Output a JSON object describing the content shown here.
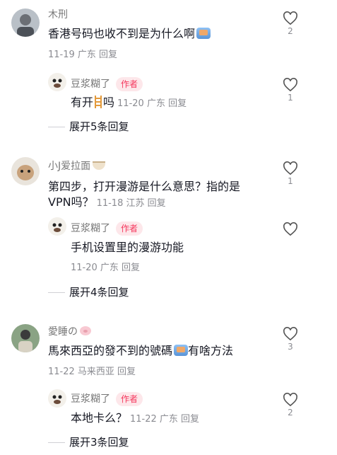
{
  "comments": [
    {
      "username": "木刑",
      "text_before": "香港号码也收不到是为什么啊",
      "text_after": "",
      "meta": "11-19 广东 回复",
      "likes": "2",
      "reply": {
        "username": "豆浆糊了",
        "badge": "作者",
        "text_before": "有开",
        "text_after": "吗",
        "meta": "11-20 广东 回复",
        "likes": "1"
      },
      "expand_label": "展开5条回复"
    },
    {
      "username": "小J爱拉面",
      "text_line1": "第四步，打开漫游是什么意思？指的是",
      "text_line2": "VPN吗？",
      "meta": "11-18 江苏 回复",
      "likes": "1",
      "reply": {
        "username": "豆浆糊了",
        "badge": "作者",
        "text": "手机设置里的漫游功能",
        "meta": "11-20 广东 回复",
        "likes": ""
      },
      "expand_label": "展开4条回复"
    },
    {
      "username": "愛睡の",
      "text_before": "馬來西亞的發不到的號碼",
      "text_after": "有啥方法",
      "meta": "11-22 马来西亚 回复",
      "likes": "3",
      "reply": {
        "username": "豆浆糊了",
        "badge": "作者",
        "text": "本地卡么？",
        "meta": "11-22 广东 回复",
        "likes": "2"
      },
      "expand_label": "展开3条回复"
    }
  ],
  "colors": {
    "badge_bg": "#fde7ea",
    "badge_text": "#f5365c",
    "meta_gray": "#8a8b91"
  },
  "icons": {
    "like": "heart-outline-icon",
    "emoji_box": "crab-box-emoji",
    "emoji_ladder": "ladder-emoji",
    "emoji_pig": "pig-emoji",
    "emoji_noodle": "noodle-bowl-emoji"
  }
}
